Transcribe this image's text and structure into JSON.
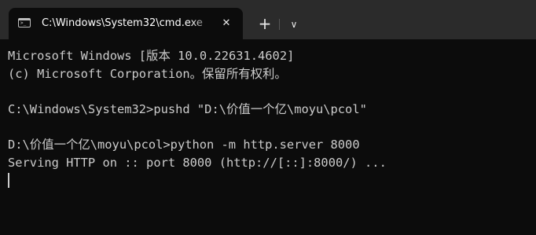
{
  "tab": {
    "title": "C:\\Windows\\System32\\cmd.exe",
    "icon": "terminal-icon",
    "icon_glyph": ">_",
    "close_glyph": "✕"
  },
  "toolbar": {
    "new_tab_glyph": "+",
    "dropdown_glyph": "∨"
  },
  "terminal": {
    "lines": [
      "Microsoft Windows [版本 10.0.22631.4602]",
      "(c) Microsoft Corporation。保留所有权利。",
      "",
      "C:\\Windows\\System32>pushd \"D:\\价值一个亿\\moyu\\pcol\"",
      "",
      "D:\\价值一个亿\\moyu\\pcol>python -m http.server 8000",
      "Serving HTTP on :: port 8000 (http://[::]:8000/) ..."
    ]
  },
  "colors": {
    "terminal_bg": "#0c0c0c",
    "titlebar_bg": "#2b2b2b",
    "text": "#cccccc"
  }
}
